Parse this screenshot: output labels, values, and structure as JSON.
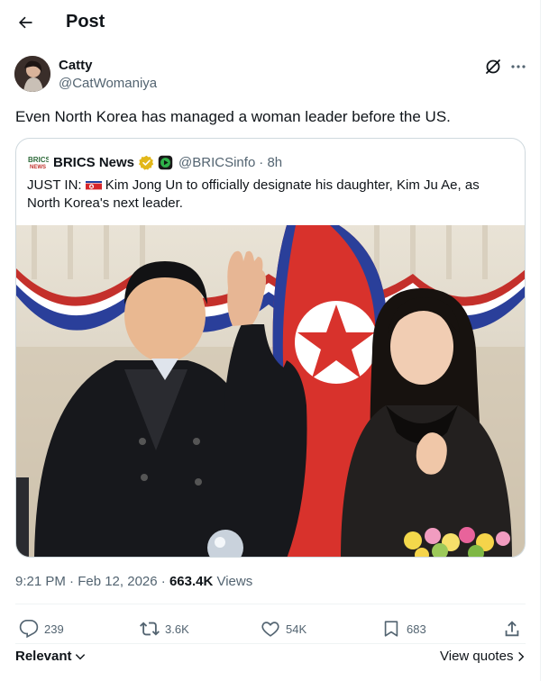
{
  "header": {
    "title": "Post"
  },
  "author": {
    "name": "Catty",
    "handle": "@CatWomaniya"
  },
  "tweet": {
    "text": "Even North Korea has managed a woman leader before the US."
  },
  "quote": {
    "logo_text": "BRICS NEWS",
    "name": "BRICS News",
    "handle": "@BRICSinfo",
    "time": "· 8h",
    "text_prefix": "JUST IN: ",
    "text_body": "Kim Jong Un to officially designate his daughter, Kim Ju Ae, as North Korea's next leader."
  },
  "meta": {
    "time_date": "9:21 PM · Feb 12, 2026 · ",
    "views_count": "663.4K",
    "views_label": " Views"
  },
  "actions": {
    "replies": "239",
    "reposts": "3.6K",
    "likes": "54K",
    "bookmarks": "683"
  },
  "footer": {
    "relevant_label": "Relevant",
    "view_quotes_label": "View quotes"
  },
  "colors": {
    "secondary_text": "#536471",
    "border": "#cfd9de",
    "verified_gold": "#e2b719",
    "flag_red": "#d7262b",
    "flag_blue": "#2341a1"
  }
}
